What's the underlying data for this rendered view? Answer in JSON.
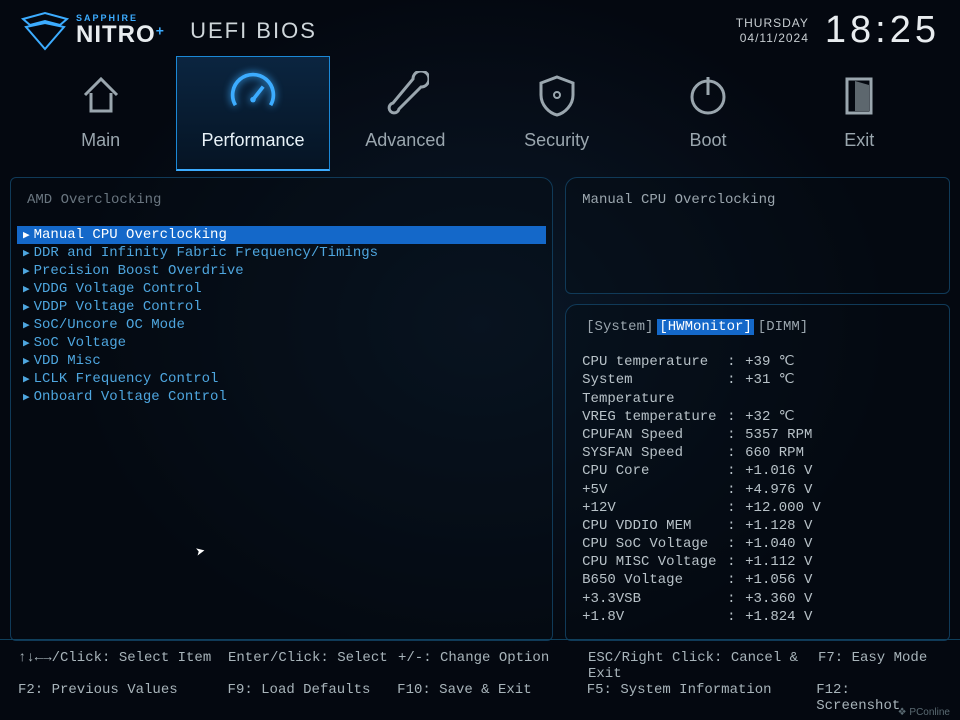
{
  "brand": {
    "sub": "SAPPHIRE",
    "name": "NITRO",
    "plus": "+",
    "title": "UEFI BIOS"
  },
  "datetime": {
    "day": "THURSDAY",
    "date": "04/11/2024",
    "time": "18:25"
  },
  "nav": {
    "items": [
      {
        "label": "Main"
      },
      {
        "label": "Performance"
      },
      {
        "label": "Advanced"
      },
      {
        "label": "Security"
      },
      {
        "label": "Boot"
      },
      {
        "label": "Exit"
      }
    ]
  },
  "section_title": "AMD Overclocking",
  "menu": [
    "Manual CPU Overclocking",
    "DDR and Infinity Fabric Frequency/Timings",
    "Precision Boost Overdrive",
    "VDDG Voltage Control",
    "VDDP Voltage Control",
    "SoC/Uncore OC Mode",
    "SoC Voltage",
    "VDD Misc",
    "LCLK Frequency Control",
    "Onboard Voltage Control"
  ],
  "help_text": "Manual CPU Overclocking",
  "hw_tabs": {
    "sys": "[System]",
    "hwm": "[HWMonitor]",
    "dimm": "[DIMM]"
  },
  "hw": [
    {
      "label": "CPU temperature",
      "value": "+39 ℃"
    },
    {
      "label": "System Temperature",
      "value": "+31 ℃"
    },
    {
      "label": "VREG temperature",
      "value": "+32 ℃"
    },
    {
      "label": "CPUFAN Speed",
      "value": "5357 RPM"
    },
    {
      "label": "SYSFAN Speed",
      "value": "660 RPM"
    },
    {
      "label": "CPU Core",
      "value": "+1.016 V"
    },
    {
      "label": "+5V",
      "value": "+4.976 V"
    },
    {
      "label": "+12V",
      "value": "+12.000 V"
    },
    {
      "label": "CPU VDDIO MEM",
      "value": "+1.128 V"
    },
    {
      "label": "CPU SoC Voltage",
      "value": "+1.040 V"
    },
    {
      "label": "CPU MISC Voltage",
      "value": "+1.112 V"
    },
    {
      "label": "B650 Voltage",
      "value": "+1.056 V"
    },
    {
      "label": "+3.3VSB",
      "value": "+3.360 V"
    },
    {
      "label": "+1.8V",
      "value": "+1.824 V"
    }
  ],
  "footer": {
    "r1": {
      "a": "↑↓←→/Click: Select Item",
      "b": "Enter/Click: Select",
      "c": "+/-: Change Option",
      "d": "ESC/Right Click: Cancel & Exit",
      "e": "F7: Easy Mode"
    },
    "r2": {
      "a": "F2: Previous Values",
      "b": "F9: Load Defaults",
      "c": "F10: Save & Exit",
      "d": "F5: System Information",
      "e": "F12: Screenshot"
    }
  },
  "watermark": "❖ PConline"
}
